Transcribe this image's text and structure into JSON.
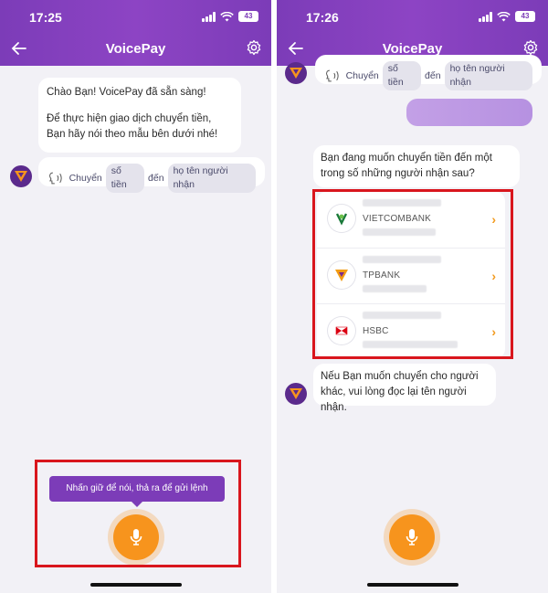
{
  "left": {
    "status": {
      "time": "17:25",
      "battery": "43"
    },
    "header": {
      "title": "VoicePay"
    },
    "greeting": {
      "line1": "Chào Bạn! VoicePay đã sẵn sàng!",
      "line2": "Để thực hiện giao dịch chuyển tiền,",
      "line3": "Bạn hãy nói theo mẫu bên dưới nhé!"
    },
    "hint": {
      "w1": "Chuyển",
      "p1": "số tiền",
      "w2": "đến",
      "p2": "họ tên người nhận"
    },
    "tooltip": "Nhấn giữ để nói, thả ra để gửi lệnh"
  },
  "right": {
    "status": {
      "time": "17:26",
      "battery": "43"
    },
    "header": {
      "title": "VoicePay"
    },
    "hint": {
      "w1": "Chuyển",
      "p1": "số tiền",
      "w2": "đến",
      "p2": "họ tên người nhận"
    },
    "question": {
      "line1": "Bạn đang muốn chuyển tiền đến một",
      "line2": "trong số những người nhận sau?"
    },
    "banks": [
      {
        "name": "VIETCOMBANK"
      },
      {
        "name": "TPBANK"
      },
      {
        "name": "HSBC"
      }
    ],
    "followup": {
      "line1": "Nếu Bạn muốn chuyển cho người",
      "line2": "khác, vui lòng đọc lại tên người nhận."
    }
  },
  "colors": {
    "header": "#7c3cb8",
    "mic": "#f7941d",
    "highlight": "#d9161d",
    "chevron": "#f29a1e"
  },
  "icons": [
    "back-arrow-icon",
    "gear-icon",
    "microphone-icon",
    "voice-wave-icon",
    "voicepay-logo-icon",
    "wifi-icon",
    "signal-icon",
    "battery-icon"
  ]
}
